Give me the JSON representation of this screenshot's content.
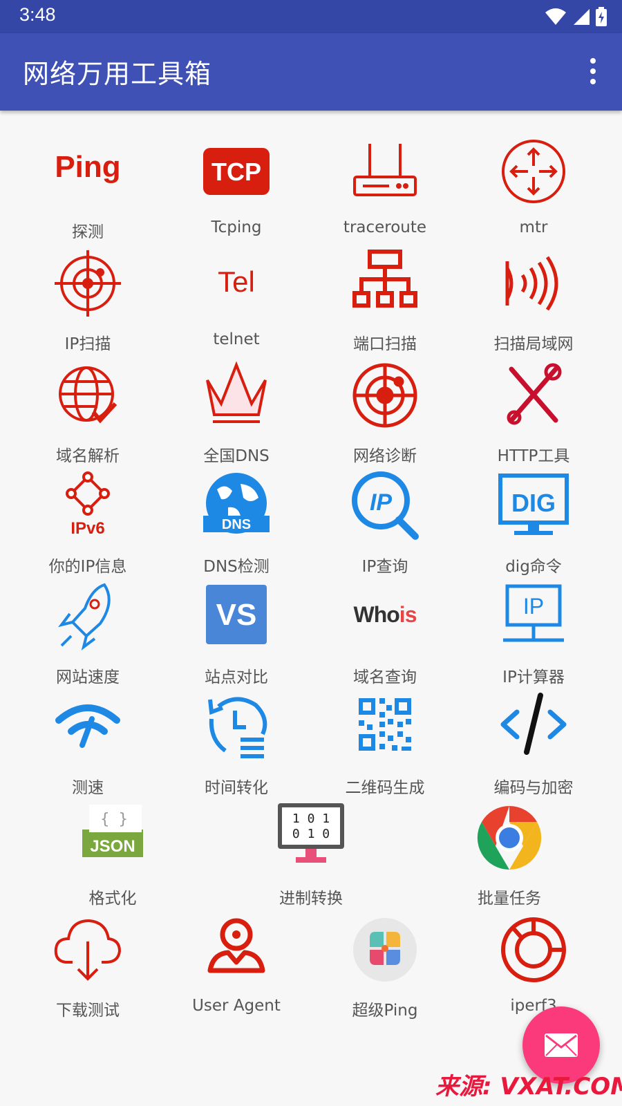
{
  "status_bar": {
    "time": "3:48"
  },
  "app_bar": {
    "title": "网络万用工具箱"
  },
  "icon_text": {
    "ping": "Ping",
    "tcp": "TCP",
    "tel": "Tel",
    "ipv6": "IPv6",
    "dns": "DNS",
    "ip": "IP",
    "dig": "DIG",
    "vs": "VS",
    "whois_main": "Who",
    "whois_accent": "is",
    "json": "JSON",
    "json_braces": "{ }",
    "binary_top": "1 0 1",
    "binary_bottom": "0 1 0"
  },
  "tools": [
    {
      "label": "探测",
      "icon": "ping-icon"
    },
    {
      "label": "Tcping",
      "icon": "tcp-icon"
    },
    {
      "label": "traceroute",
      "icon": "router-icon"
    },
    {
      "label": "mtr",
      "icon": "crosshair-arrows-icon"
    },
    {
      "label": "IP扫描",
      "icon": "target-scan-icon"
    },
    {
      "label": "telnet",
      "icon": "telnet-icon"
    },
    {
      "label": "端口扫描",
      "icon": "network-tree-icon"
    },
    {
      "label": "扫描局域网",
      "icon": "signal-waves-icon"
    },
    {
      "label": "域名解析",
      "icon": "globe-check-icon"
    },
    {
      "label": "全国DNS",
      "icon": "crown-icon"
    },
    {
      "label": "网络诊断",
      "icon": "radar-icon"
    },
    {
      "label": "HTTP工具",
      "icon": "tools-icon"
    },
    {
      "label": "你的IP信息",
      "icon": "ipv6-icon"
    },
    {
      "label": "DNS检测",
      "icon": "dns-globe-icon"
    },
    {
      "label": "IP查询",
      "icon": "ip-search-icon"
    },
    {
      "label": "dig命令",
      "icon": "dig-monitor-icon"
    },
    {
      "label": "网站速度",
      "icon": "rocket-icon"
    },
    {
      "label": "站点对比",
      "icon": "vs-icon"
    },
    {
      "label": "域名查询",
      "icon": "whois-icon"
    },
    {
      "label": "IP计算器",
      "icon": "ip-monitor-icon"
    },
    {
      "label": "测速",
      "icon": "speed-wifi-icon"
    },
    {
      "label": "时间转化",
      "icon": "time-convert-icon"
    },
    {
      "label": "二维码生成",
      "icon": "qr-code-icon"
    },
    {
      "label": "编码与加密",
      "icon": "code-icon"
    },
    {
      "label": "格式化",
      "icon": "json-icon"
    },
    {
      "label": "进制转换",
      "icon": "binary-monitor-icon"
    },
    {
      "label": "批量任务",
      "icon": "chrome-circle-icon"
    },
    {
      "label": "下载测试",
      "icon": "cloud-download-icon"
    },
    {
      "label": "User Agent",
      "icon": "user-agent-icon"
    },
    {
      "label": "超级Ping",
      "icon": "super-ping-icon"
    },
    {
      "label": "iperf3",
      "icon": "iperf-icon"
    }
  ],
  "colors": {
    "status_bar": "#3446a6",
    "app_bar": "#3f51b5",
    "red": "#d71e0f",
    "blue": "#1e88e5",
    "fab": "#fb3a7c"
  },
  "watermark": "来源: VXAT.COM"
}
